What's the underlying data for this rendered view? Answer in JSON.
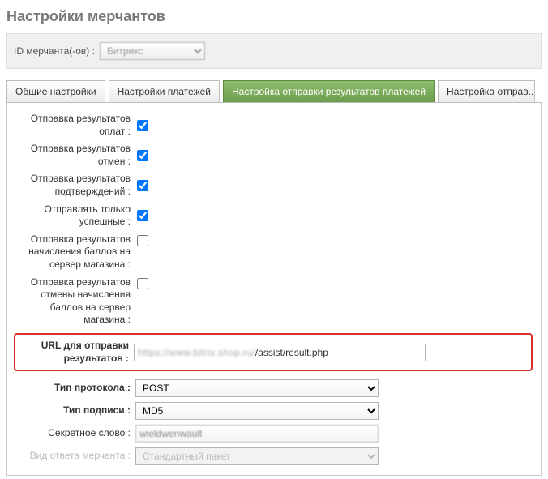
{
  "page": {
    "title": "Настройки мерчантов"
  },
  "merchant": {
    "label": "ID мерчанта(-ов) :",
    "selected": "Битрикс"
  },
  "tabs": [
    {
      "label": "Общие настройки",
      "active": false
    },
    {
      "label": "Настройки платежей",
      "active": false
    },
    {
      "label": "Настройка отправки результатов платежей",
      "active": true
    },
    {
      "label": "Настройка отправ...",
      "active": false
    }
  ],
  "checkboxes": {
    "send_payment_results": {
      "label": "Отправка результатов оплат :",
      "checked": true
    },
    "send_cancel_results": {
      "label": "Отправка результатов отмен :",
      "checked": true
    },
    "send_confirm_results": {
      "label": "Отправка результатов подтверждений :",
      "checked": true
    },
    "send_only_success": {
      "label": "Отправлять только успешные :",
      "checked": true
    },
    "send_bonus_results": {
      "label": "Отправка результатов начисления баллов на сервер магазина :",
      "checked": false
    },
    "send_cancel_bonus_results": {
      "label": "Отправка результатов отмены начисления баллов на сервер магазина :",
      "checked": false
    }
  },
  "url_row": {
    "label": "URL для отправки результатов :",
    "prefix_hidden": "https://www.bitrix.shop.ru/",
    "suffix_visible": "/assist/result.php"
  },
  "protocol": {
    "label": "Тип протокола :",
    "value": "POST"
  },
  "signature": {
    "label": "Тип подписи :",
    "value": "MD5"
  },
  "secret": {
    "label": "Секретное слово :",
    "value": "wieldwenwault"
  },
  "response_type": {
    "label": "Вид ответа мерчанта :",
    "value": "Стандартный пакет"
  }
}
